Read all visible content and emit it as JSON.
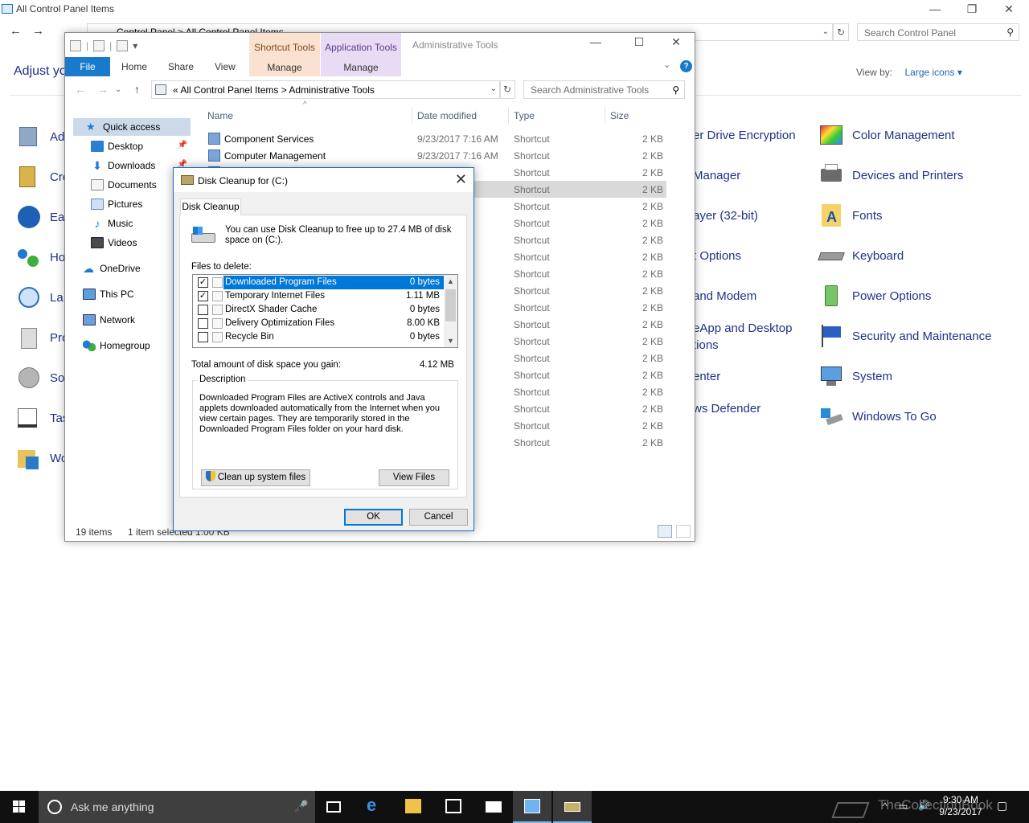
{
  "control_panel": {
    "window_title": "All Control Panel Items",
    "breadcrumb": "Control Panel  >  All Control Panel Items",
    "search_placeholder": "Search Control Panel",
    "heading": "Adjust yo",
    "view_by_label": "View by:",
    "view_by_value": "Large icons ▾",
    "items_left": [
      "Ad",
      "Cre",
      "Eas",
      "Ho",
      "La",
      "Pro",
      "So",
      "Tas",
      "Wo"
    ],
    "items_mid": [
      "er Drive Encryption",
      "Manager",
      "ayer (32-bit)",
      "t Options",
      "and Modem",
      "eApp and Desktop\ntions",
      "enter",
      "ws Defender"
    ],
    "items_right": [
      "Color Management",
      "Devices and Printers",
      "Fonts",
      "Keyboard",
      "Power Options",
      "Security and Maintenance",
      "System",
      "Windows To Go"
    ]
  },
  "explorer": {
    "title": "Administrative Tools",
    "ctx_shortcut_tools": "Shortcut Tools",
    "ctx_application_tools": "Application Tools",
    "manage_label": "Manage",
    "ribbon_tabs": {
      "file": "File",
      "home": "Home",
      "share": "Share",
      "view": "View"
    },
    "address": "«  All Control Panel Items  >  Administrative Tools",
    "search_placeholder": "Search Administrative Tools",
    "nav": [
      "Quick access",
      "Desktop",
      "Downloads",
      "Documents",
      "Pictures",
      "Music",
      "Videos",
      "OneDrive",
      "This PC",
      "Network",
      "Homegroup"
    ],
    "columns": {
      "name": "Name",
      "date": "Date modified",
      "type": "Type",
      "size": "Size"
    },
    "rows": [
      {
        "name": "Component Services",
        "date": "9/23/2017 7:16 AM",
        "type": "Shortcut",
        "size": "2 KB"
      },
      {
        "name": "Computer Management",
        "date": "9/23/2017 7:16 AM",
        "type": "Shortcut",
        "size": "2 KB"
      },
      {
        "name": "",
        "date": "6 AM",
        "type": "Shortcut",
        "size": "2 KB"
      },
      {
        "name": "",
        "date": "6 AM",
        "type": "Shortcut",
        "size": "2 KB"
      },
      {
        "name": "",
        "date": "6 AM",
        "type": "Shortcut",
        "size": "2 KB"
      },
      {
        "name": "",
        "date": "6 AM",
        "type": "Shortcut",
        "size": "2 KB"
      },
      {
        "name": "",
        "date": "7 AM",
        "type": "Shortcut",
        "size": "2 KB"
      },
      {
        "name": "",
        "date": "6 AM",
        "type": "Shortcut",
        "size": "2 KB"
      },
      {
        "name": "",
        "date": "6 AM",
        "type": "Shortcut",
        "size": "2 KB"
      },
      {
        "name": "",
        "date": "6 AM",
        "type": "Shortcut",
        "size": "2 KB"
      },
      {
        "name": "",
        "date": "7 AM",
        "type": "Shortcut",
        "size": "2 KB"
      },
      {
        "name": "",
        "date": "6 AM",
        "type": "Shortcut",
        "size": "2 KB"
      },
      {
        "name": "",
        "date": "6 AM",
        "type": "Shortcut",
        "size": "2 KB"
      },
      {
        "name": "",
        "date": "6 AM",
        "type": "Shortcut",
        "size": "2 KB"
      },
      {
        "name": "",
        "date": "6 AM",
        "type": "Shortcut",
        "size": "2 KB"
      },
      {
        "name": "",
        "date": "6 AM",
        "type": "Shortcut",
        "size": "2 KB"
      },
      {
        "name": "",
        "date": "6 AM",
        "type": "Shortcut",
        "size": "2 KB"
      },
      {
        "name": "",
        "date": "6 AM",
        "type": "Shortcut",
        "size": "2 KB"
      },
      {
        "name": "",
        "date": "6 AM",
        "type": "Shortcut",
        "size": "2 KB"
      }
    ],
    "status_items": "19 items",
    "status_selected": "1 item selected  1.00 KB"
  },
  "dialog": {
    "title": "Disk Cleanup for  (C:)",
    "tab": "Disk Cleanup",
    "intro": "You can use Disk Cleanup to free up to 27.4 MB of disk space on  (C:).",
    "files_to_delete": "Files to delete:",
    "files": [
      {
        "name": "Downloaded Program Files",
        "size": "0 bytes",
        "checked": "✓"
      },
      {
        "name": "Temporary Internet Files",
        "size": "1.11 MB",
        "checked": "✓"
      },
      {
        "name": "DirectX Shader Cache",
        "size": "0 bytes",
        "checked": ""
      },
      {
        "name": "Delivery Optimization Files",
        "size": "8.00 KB",
        "checked": ""
      },
      {
        "name": "Recycle Bin",
        "size": "0 bytes",
        "checked": ""
      }
    ],
    "total_label": "Total amount of disk space you gain:",
    "total_value": "4.12 MB",
    "description_label": "Description",
    "description": "Downloaded Program Files are ActiveX controls and Java applets downloaded automatically from the Internet when you view certain pages. They are temporarily stored in the Downloaded Program Files folder on your hard disk.",
    "cleanup_system_files": "Clean up system files",
    "view_files": "View Files",
    "ok": "OK",
    "cancel": "Cancel"
  },
  "taskbar": {
    "search_placeholder": "Ask me anything",
    "time": "9:30 AM",
    "date": "9/23/2017",
    "watermark": "TheCollectionBook"
  }
}
